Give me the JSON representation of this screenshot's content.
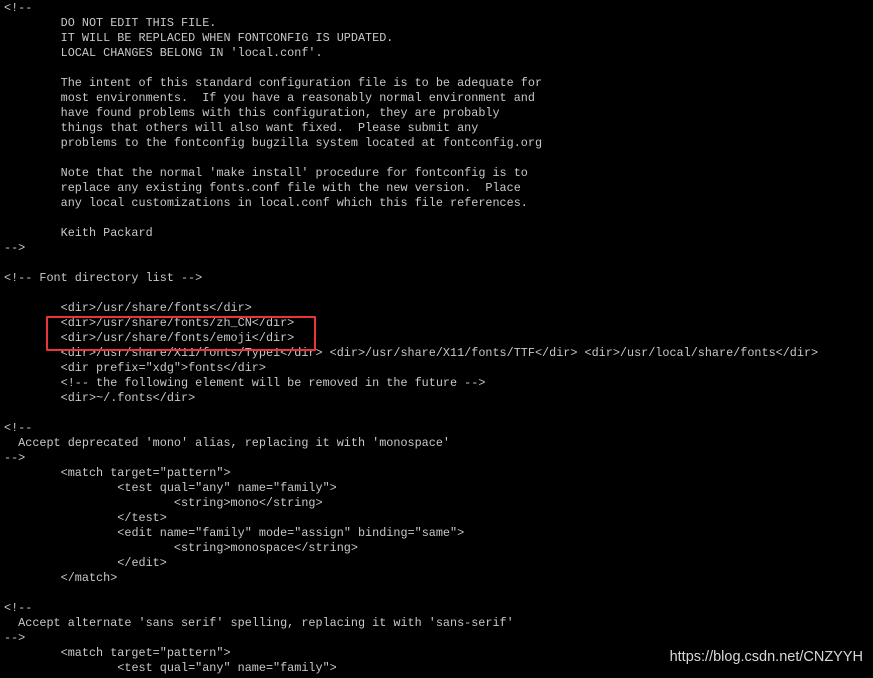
{
  "terminal": {
    "text_color": "#c8c8c8",
    "background": "#000000",
    "lines": [
      "<!--",
      "\tDO NOT EDIT THIS FILE.",
      "\tIT WILL BE REPLACED WHEN FONTCONFIG IS UPDATED.",
      "\tLOCAL CHANGES BELONG IN 'local.conf'.",
      "",
      "\tThe intent of this standard configuration file is to be adequate for",
      "\tmost environments.  If you have a reasonably normal environment and",
      "\thave found problems with this configuration, they are probably",
      "\tthings that others will also want fixed.  Please submit any",
      "\tproblems to the fontconfig bugzilla system located at fontconfig.org",
      "",
      "\tNote that the normal 'make install' procedure for fontconfig is to",
      "\treplace any existing fonts.conf file with the new version.  Place",
      "\tany local customizations in local.conf which this file references.",
      "",
      "\tKeith Packard",
      "-->",
      "",
      "<!-- Font directory list -->",
      "",
      "\t<dir>/usr/share/fonts</dir>",
      "\t<dir>/usr/share/fonts/zh_CN</dir>",
      "\t<dir>/usr/share/fonts/emoji</dir>",
      "\t<dir>/usr/share/X11/fonts/Type1</dir> <dir>/usr/share/X11/fonts/TTF</dir> <dir>/usr/local/share/fonts</dir>",
      "\t<dir prefix=\"xdg\">fonts</dir>",
      "\t<!-- the following element will be removed in the future -->",
      "\t<dir>~/.fonts</dir>",
      "",
      "<!--",
      "  Accept deprecated 'mono' alias, replacing it with 'monospace'",
      "-->",
      "\t<match target=\"pattern\">",
      "\t\t<test qual=\"any\" name=\"family\">",
      "\t\t\t<string>mono</string>",
      "\t\t</test>",
      "\t\t<edit name=\"family\" mode=\"assign\" binding=\"same\">",
      "\t\t\t<string>monospace</string>",
      "\t\t</edit>",
      "\t</match>",
      "",
      "<!--",
      "  Accept alternate 'sans serif' spelling, replacing it with 'sans-serif'",
      "-->",
      "\t<match target=\"pattern\">",
      "\t\t<test qual=\"any\" name=\"family\">"
    ]
  },
  "annotation": {
    "color": "#e8343a"
  },
  "watermark": "https://blog.csdn.net/CNZYYH"
}
